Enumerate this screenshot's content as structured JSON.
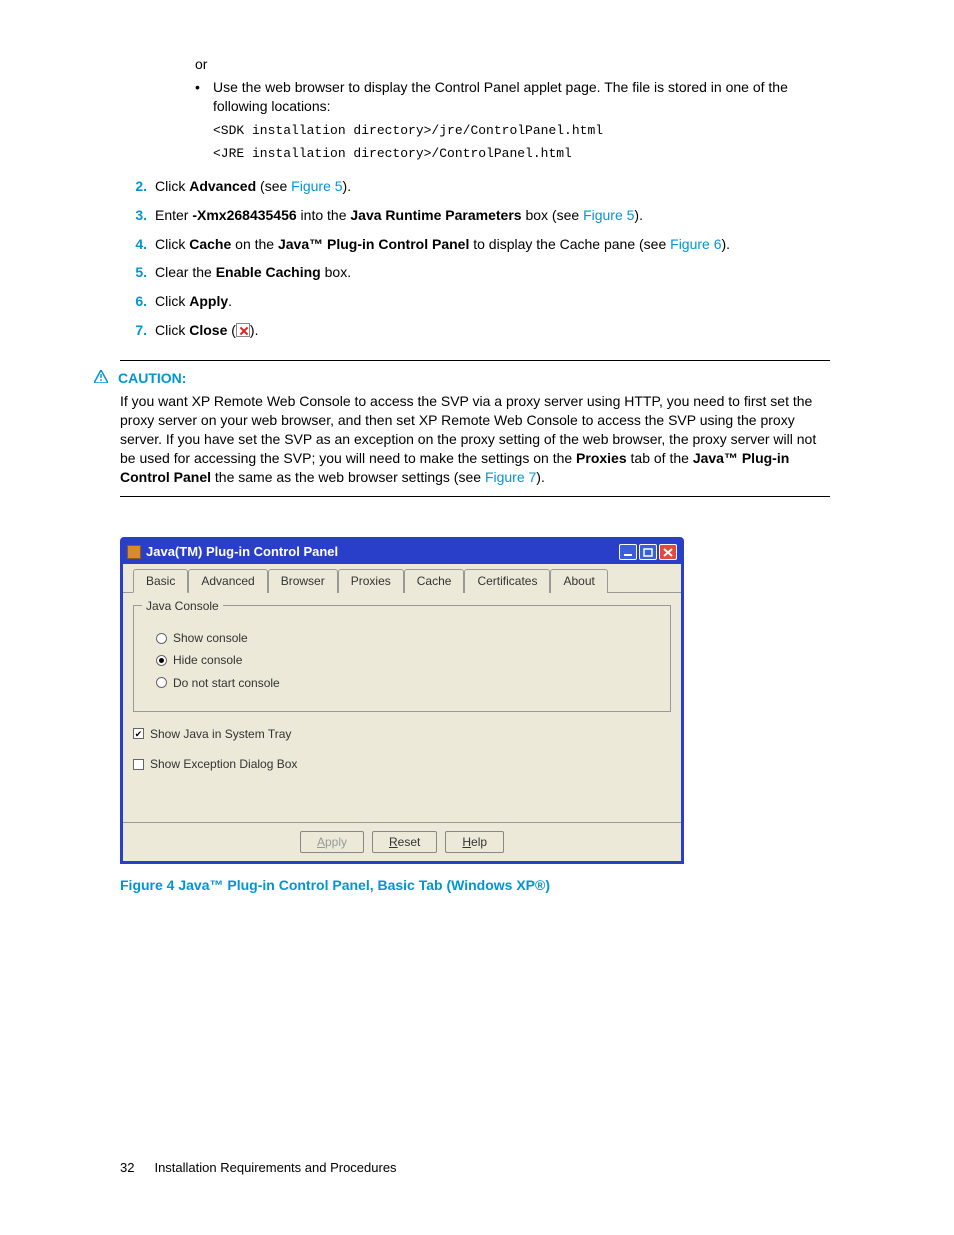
{
  "intro": {
    "or": "or",
    "bullet": "Use the web browser to display the Control Panel applet page.  The file is stored in one of the following locations:",
    "path1": "<SDK installation directory>/jre/ControlPanel.html",
    "path2": "<JRE installation directory>/ControlPanel.html"
  },
  "steps": [
    {
      "num": "2.",
      "pre": "Click ",
      "bold1": "Advanced",
      "mid": " (see ",
      "link": "Figure 5",
      "post": ")."
    },
    {
      "num": "3.",
      "pre": "Enter ",
      "bold1": "-Xmx268435456",
      "mid": " into the ",
      "bold2": "Java Runtime Parameters",
      "mid2": " box (see ",
      "link": "Figure 5",
      "post": ")."
    },
    {
      "num": "4.",
      "pre": "Click ",
      "bold1": "Cache",
      "mid": " on the ",
      "bold2": "Java™ Plug-in Control Panel",
      "mid2": " to display the Cache pane (see ",
      "link": "Figure 6",
      "post": ")."
    },
    {
      "num": "5.",
      "pre": "Clear the ",
      "bold1": "Enable Caching",
      "post": " box."
    },
    {
      "num": "6.",
      "pre": "Click ",
      "bold1": "Apply",
      "post": "."
    },
    {
      "num": "7.",
      "pre": "Click ",
      "bold1": "Close",
      "mid": " (",
      "icon": true,
      "post": ")."
    }
  ],
  "caution": {
    "label": "CAUTION:",
    "body_pre": "If you want XP Remote Web Console to access the SVP via a proxy server using HTTP, you need to first set the proxy server on your web browser, and then set XP Remote Web Console to access the SVP using the proxy server.  If you have set the SVP as an exception on the proxy setting of the web browser, the proxy server will not be used for accessing the SVP; you will need to make the settings on the ",
    "bold1": "Proxies",
    "body_mid": " tab of the ",
    "bold2": "Java™ Plug-in Control Panel",
    "body_mid2": " the same as the web browser settings (see ",
    "link": "Figure 7",
    "body_post": ")."
  },
  "java_window": {
    "title": "Java(TM) Plug-in Control Panel",
    "tabs": [
      "Basic",
      "Advanced",
      "Browser",
      "Proxies",
      "Cache",
      "Certificates",
      "About"
    ],
    "fieldset_legend": "Java Console",
    "radios": [
      {
        "label": "Show console",
        "checked": false
      },
      {
        "label": "Hide console",
        "checked": true
      },
      {
        "label": "Do not start console",
        "checked": false
      }
    ],
    "checks": [
      {
        "label": "Show Java in System Tray",
        "checked": true
      },
      {
        "label": "Show Exception Dialog Box",
        "checked": false
      }
    ],
    "buttons": {
      "apply": "Apply",
      "reset": "Reset",
      "help": "Help"
    }
  },
  "figure_caption": "Figure 4 Java™ Plug-in Control Panel, Basic Tab (Windows XP®)",
  "footer": {
    "page": "32",
    "section": "Installation Requirements and Procedures"
  }
}
